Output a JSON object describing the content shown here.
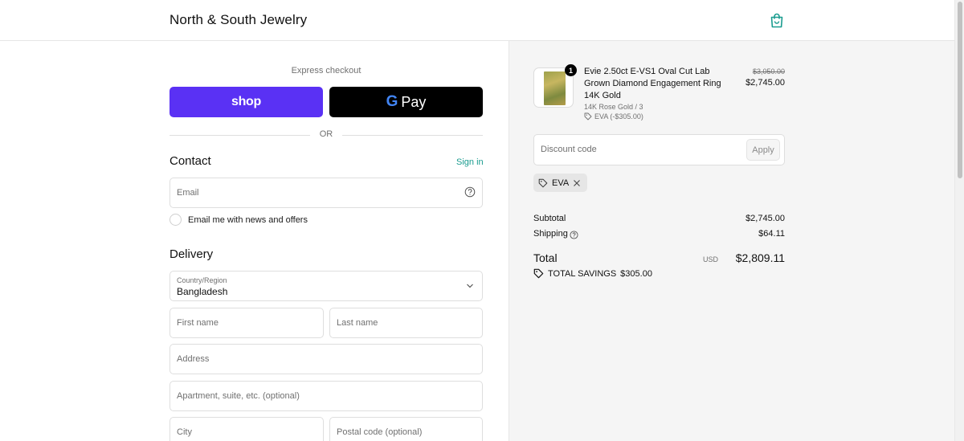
{
  "header": {
    "store_name": "North & South Jewelry",
    "bag_icon": "shopping-bag-icon",
    "accent": "#1a9c8f"
  },
  "express": {
    "title": "Express checkout",
    "shop_label": "shop",
    "shop_color": "#5a31f4",
    "gpay_g": "G",
    "gpay_label": "Pay",
    "or": "OR"
  },
  "contact": {
    "heading": "Contact",
    "sign_in": "Sign in",
    "email_placeholder": "Email",
    "newsletter_label": "Email me with news and offers"
  },
  "delivery": {
    "heading": "Delivery",
    "country_label": "Country/Region",
    "country_value": "Bangladesh",
    "first_name": "First name",
    "last_name": "Last name",
    "address": "Address",
    "apartment": "Apartment, suite, etc. (optional)",
    "city": "City",
    "postal": "Postal code (optional)"
  },
  "summary": {
    "quantity": "1",
    "product_name": "Evie 2.50ct E-VS1 Oval Cut Lab Grown Diamond Engagement Ring 14K Gold",
    "variant": "14K Rose Gold / 3",
    "discount_line": "EVA (-$305.00)",
    "price_original": "$3,050.00",
    "price_current": "$2,745.00",
    "discount_placeholder": "Discount code",
    "apply_label": "Apply",
    "chip_code": "EVA",
    "subtotal_label": "Subtotal",
    "subtotal_value": "$2,745.00",
    "shipping_label": "Shipping",
    "shipping_value": "$64.11",
    "total_label": "Total",
    "currency": "USD",
    "total_value": "$2,809.11",
    "savings_label": "TOTAL SAVINGS",
    "savings_value": "$305.00"
  }
}
